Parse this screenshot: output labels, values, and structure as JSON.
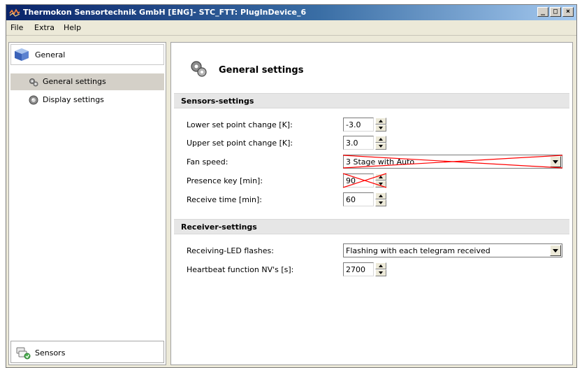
{
  "window": {
    "title": "Thermokon Sensortechnik GmbH [ENG]- STC_FTT: PlugInDevice_6",
    "min_label": "_",
    "max_label": "□",
    "close_label": "×"
  },
  "menu": [
    "File",
    "Extra",
    "Help"
  ],
  "sidebar": {
    "header": {
      "label": "General",
      "icon": "cube-icon"
    },
    "items": [
      {
        "label": "General settings",
        "icon": "gears-icon",
        "selected": true
      },
      {
        "label": "Display settings",
        "icon": "display-icon",
        "selected": false
      }
    ],
    "footer": {
      "label": "Sensors",
      "icon": "sensors-icon"
    }
  },
  "page": {
    "title": "General settings",
    "sections": [
      {
        "title": "Sensors-settings",
        "fields": [
          {
            "label": "Lower set point change [K]:",
            "type": "spin",
            "value": "-3.0"
          },
          {
            "label": "Upper set point change [K]:",
            "type": "spin",
            "value": "3.0"
          },
          {
            "label": "Fan speed:",
            "type": "select",
            "value": "3 Stage with Auto",
            "crossed_out": true
          },
          {
            "label": "Presence key [min]:",
            "type": "spin",
            "value": "90",
            "crossed_out": true
          },
          {
            "label": "Receive time [min]:",
            "type": "spin",
            "value": "60"
          }
        ]
      },
      {
        "title": "Receiver-settings",
        "fields": [
          {
            "label": "Receiving-LED flashes:",
            "type": "select",
            "value": "Flashing with each telegram received"
          },
          {
            "label": "Heartbeat function NV's [s]:",
            "type": "spin",
            "value": "2700"
          }
        ]
      }
    ]
  },
  "colors": {
    "title_gradient_start": "#0a246a",
    "title_gradient_end": "#a6caf0",
    "window_bg": "#ece9d8",
    "selected_item_bg": "#d4d0c8",
    "cross_out": "#ff0000"
  }
}
